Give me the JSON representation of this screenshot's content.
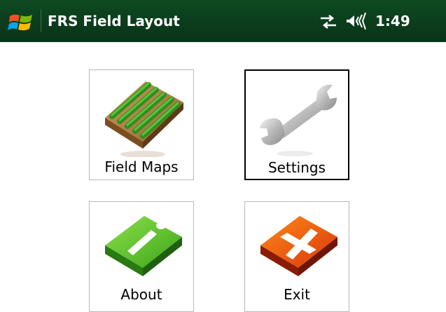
{
  "header": {
    "app_title": "FRS Field Layout",
    "clock": "1:49",
    "start_icon": "windows-flag-icon",
    "connectivity_icon": "connectivity-arrows-icon",
    "volume_icon": "speaker-volume-icon",
    "background_color": "#0b3d1c"
  },
  "tiles": [
    {
      "label": "Field Maps",
      "icon": "field-rows-icon",
      "selected": false
    },
    {
      "label": "Settings",
      "icon": "wrench-icon",
      "selected": true
    },
    {
      "label": "About",
      "icon": "info-icon",
      "selected": false
    },
    {
      "label": "Exit",
      "icon": "exit-x-icon",
      "selected": false
    }
  ]
}
